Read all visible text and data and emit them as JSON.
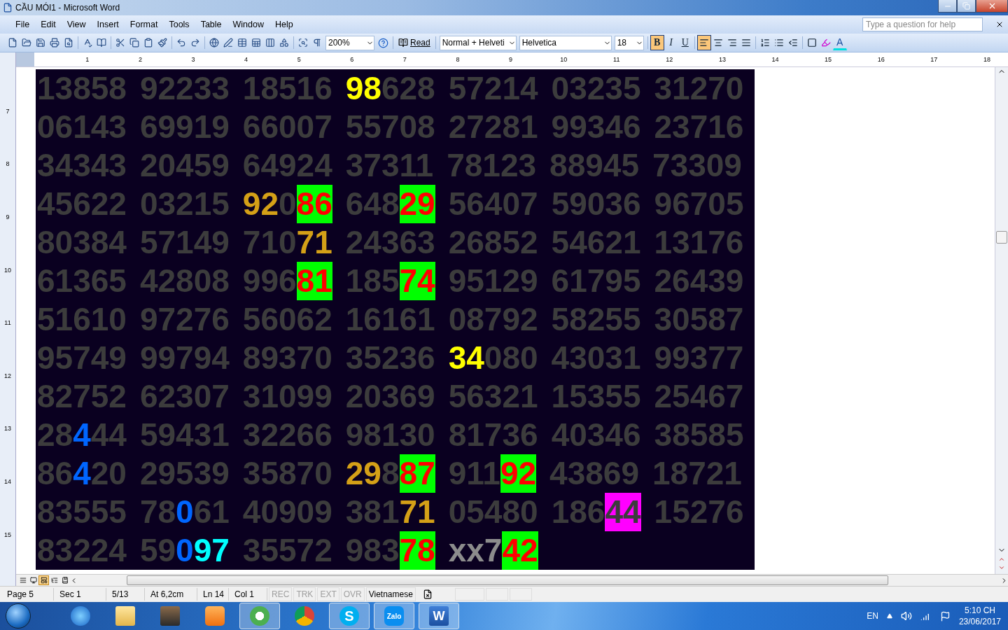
{
  "window": {
    "title": "CẦU MÓI1 - Microsoft Word"
  },
  "menu": [
    "File",
    "Edit",
    "View",
    "Insert",
    "Format",
    "Tools",
    "Table",
    "Window",
    "Help"
  ],
  "help_box": {
    "placeholder": "Type a question for help"
  },
  "standard_toolbar": [
    {
      "kind": "new"
    },
    {
      "kind": "open"
    },
    {
      "kind": "save"
    },
    {
      "kind": "print"
    },
    {
      "kind": "preview"
    },
    {
      "kind": "spelling"
    },
    {
      "kind": "research"
    },
    {
      "kind": "cut"
    },
    {
      "kind": "copy"
    },
    {
      "kind": "paste"
    },
    {
      "kind": "format-painter"
    },
    {
      "kind": "undo"
    },
    {
      "kind": "redo"
    },
    {
      "kind": "hyperlink"
    },
    {
      "kind": "draw-table"
    },
    {
      "kind": "table"
    },
    {
      "kind": "sheet"
    },
    {
      "kind": "columns"
    },
    {
      "kind": "drawing"
    },
    {
      "kind": "document-map"
    },
    {
      "kind": "pilcrow"
    }
  ],
  "zoom": "200%",
  "read_button": "Read",
  "formatting": {
    "style": "Normal + Helveti",
    "font": "Helvetica",
    "size": "18",
    "toggles": [
      {
        "label": "B",
        "kind": "bold",
        "selected": true
      },
      {
        "label": "I",
        "kind": "italic",
        "selected": false
      },
      {
        "label": "U",
        "kind": "underline",
        "selected": false
      }
    ],
    "alignment": [
      {
        "kind": "left",
        "selected": true
      },
      {
        "kind": "center",
        "selected": false
      },
      {
        "kind": "right",
        "selected": false
      },
      {
        "kind": "justify",
        "selected": false
      }
    ],
    "font_color_label": "A"
  },
  "ruler": {
    "horizontal": [
      "1",
      "2",
      "3",
      "4",
      "5",
      "6",
      "7",
      "8",
      "9",
      "10",
      "11",
      "12",
      "13",
      "14",
      "15",
      "16",
      "17",
      "18"
    ],
    "vertical": [
      "7",
      "8",
      "9",
      "10",
      "11",
      "12",
      "13",
      "14",
      "15"
    ]
  },
  "document": {
    "rows": [
      [
        [
          {
            "text": "13858"
          }
        ],
        [
          {
            "text": "92233"
          }
        ],
        [
          {
            "text": "18516"
          }
        ],
        [
          {
            "text": "98",
            "color": "#ffff00"
          },
          {
            "text": "628"
          }
        ],
        [
          {
            "text": "57214"
          }
        ],
        [
          {
            "text": "03235"
          }
        ],
        [
          {
            "text": "31270"
          }
        ]
      ],
      [
        [
          {
            "text": "06143"
          }
        ],
        [
          {
            "text": "69919"
          }
        ],
        [
          {
            "text": "66007"
          }
        ],
        [
          {
            "text": "55708"
          }
        ],
        [
          {
            "text": "27281"
          }
        ],
        [
          {
            "text": "99346"
          }
        ],
        [
          {
            "text": "23716"
          }
        ]
      ],
      [
        [
          {
            "text": "34343"
          }
        ],
        [
          {
            "text": "20459"
          }
        ],
        [
          {
            "text": "64924"
          }
        ],
        [
          {
            "text": "37311"
          }
        ],
        [
          {
            "text": "78123"
          }
        ],
        [
          {
            "text": "88945"
          }
        ],
        [
          {
            "text": "73309"
          }
        ]
      ],
      [
        [
          {
            "text": "45622"
          }
        ],
        [
          {
            "text": "03215"
          }
        ],
        [
          {
            "text": "92",
            "color": "#d4a017"
          },
          {
            "text": "0"
          },
          {
            "text": "86",
            "color": "#ff0000",
            "highlight": {
              "color": "#00ff00"
            }
          }
        ],
        [
          {
            "text": "648"
          },
          {
            "text": "29",
            "color": "#ff0000",
            "highlight": {
              "color": "#00ff00"
            }
          }
        ],
        [
          {
            "text": "56407"
          }
        ],
        [
          {
            "text": "59036"
          }
        ],
        [
          {
            "text": "96705"
          }
        ]
      ],
      [
        [
          {
            "text": "80384"
          }
        ],
        [
          {
            "text": "57149"
          }
        ],
        [
          {
            "text": "710"
          },
          {
            "text": "71",
            "color": "#d4a017"
          }
        ],
        [
          {
            "text": "24363"
          }
        ],
        [
          {
            "text": "26852"
          }
        ],
        [
          {
            "text": "54621"
          }
        ],
        [
          {
            "text": "13176"
          }
        ]
      ],
      [
        [
          {
            "text": "61365"
          }
        ],
        [
          {
            "text": "42808"
          }
        ],
        [
          {
            "text": "996"
          },
          {
            "text": "81",
            "color": "#ff0000",
            "highlight": {
              "color": "#00ff00"
            }
          }
        ],
        [
          {
            "text": "185"
          },
          {
            "text": "74",
            "color": "#ff0000",
            "highlight": {
              "color": "#00ff00"
            }
          }
        ],
        [
          {
            "text": "95129"
          }
        ],
        [
          {
            "text": "61795"
          }
        ],
        [
          {
            "text": "26439"
          }
        ]
      ],
      [
        [
          {
            "text": "51610"
          }
        ],
        [
          {
            "text": "97276"
          }
        ],
        [
          {
            "text": "56062"
          }
        ],
        [
          {
            "text": "16161"
          }
        ],
        [
          {
            "text": "08792"
          }
        ],
        [
          {
            "text": "58255"
          }
        ],
        [
          {
            "text": "30587"
          }
        ]
      ],
      [
        [
          {
            "text": "95749"
          }
        ],
        [
          {
            "text": "99794"
          }
        ],
        [
          {
            "text": "89370"
          }
        ],
        [
          {
            "text": "35236"
          }
        ],
        [
          {
            "text": "34",
            "color": "#ffff00"
          },
          {
            "text": "080"
          }
        ],
        [
          {
            "text": "43031"
          }
        ],
        [
          {
            "text": "99377"
          }
        ]
      ],
      [
        [
          {
            "text": "82752"
          }
        ],
        [
          {
            "text": "62307"
          }
        ],
        [
          {
            "text": "31099"
          }
        ],
        [
          {
            "text": "20369"
          }
        ],
        [
          {
            "text": "56321"
          }
        ],
        [
          {
            "text": "15355"
          }
        ],
        [
          {
            "text": "25467"
          }
        ]
      ],
      [
        [
          {
            "text": "28"
          },
          {
            "text": "4",
            "color": "#0066ff"
          },
          {
            "text": "44"
          }
        ],
        [
          {
            "text": "59431"
          }
        ],
        [
          {
            "text": "32266"
          }
        ],
        [
          {
            "text": "98130"
          }
        ],
        [
          {
            "text": "81736"
          }
        ],
        [
          {
            "text": "40346"
          }
        ],
        [
          {
            "text": "38585"
          }
        ]
      ],
      [
        [
          {
            "text": "86"
          },
          {
            "text": "4",
            "color": "#0066ff"
          },
          {
            "text": "20"
          }
        ],
        [
          {
            "text": "29539"
          }
        ],
        [
          {
            "text": "35870"
          }
        ],
        [
          {
            "text": "29",
            "color": "#d4a017"
          },
          {
            "text": "8"
          },
          {
            "text": "87",
            "color": "#ff0000",
            "highlight": {
              "color": "#00ff00"
            }
          }
        ],
        [
          {
            "text": "911"
          },
          {
            "text": "92",
            "color": "#ff0000",
            "highlight": {
              "color": "#00ff00"
            }
          }
        ],
        [
          {
            "text": "43869"
          }
        ],
        [
          {
            "text": "18721"
          }
        ]
      ],
      [
        [
          {
            "text": "83555"
          }
        ],
        [
          {
            "text": "78"
          },
          {
            "text": "0",
            "color": "#0066ff"
          },
          {
            "text": "61"
          }
        ],
        [
          {
            "text": "40909"
          }
        ],
        [
          {
            "text": "381"
          },
          {
            "text": "71",
            "color": "#d4a017"
          }
        ],
        [
          {
            "text": "05480"
          }
        ],
        [
          {
            "text": "186"
          },
          {
            "text": "44",
            "highlight": {
              "color": "#ff00ff"
            }
          }
        ],
        [
          {
            "text": "15276"
          }
        ]
      ],
      [
        [
          {
            "text": "83224"
          }
        ],
        [
          {
            "text": "59"
          },
          {
            "text": "0",
            "color": "#0066ff"
          },
          {
            "text": "97",
            "color": "#00ffff"
          }
        ],
        [
          {
            "text": "35572"
          }
        ],
        [
          {
            "text": "983"
          },
          {
            "text": "78",
            "color": "#ff0000",
            "highlight": {
              "color": "#00ff00"
            }
          }
        ],
        [
          {
            "text": "xx7",
            "color": "#8c8c8c"
          },
          {
            "text": "42",
            "color": "#ff0000",
            "highlight": {
              "color": "#00ff00"
            }
          }
        ]
      ]
    ]
  },
  "view_buttons": [
    {
      "kind": "normal",
      "selected": false
    },
    {
      "kind": "web",
      "selected": false
    },
    {
      "kind": "print",
      "selected": true
    },
    {
      "kind": "outline",
      "selected": false
    },
    {
      "kind": "reading",
      "selected": false
    }
  ],
  "status_bar": {
    "fields": [
      "Page 5",
      "Sec 1",
      "5/13",
      "At 6,2cm",
      "Ln 14",
      "Col 1"
    ],
    "modes": [
      {
        "label": "REC",
        "disabled": true
      },
      {
        "label": "TRK",
        "disabled": true
      },
      {
        "label": "EXT",
        "disabled": true
      },
      {
        "label": "OVR",
        "disabled": true
      }
    ],
    "language": "Vietnamese"
  },
  "taskbar": {
    "apps": [
      {
        "kind": "ie",
        "active": false
      },
      {
        "kind": "folder",
        "active": false
      },
      {
        "kind": "camera",
        "active": false
      },
      {
        "kind": "media",
        "active": false
      },
      {
        "kind": "coccoc",
        "active": true
      },
      {
        "kind": "chrome",
        "active": false
      },
      {
        "kind": "skype",
        "label": "S",
        "active": true
      },
      {
        "kind": "zalo",
        "label": "Zalo",
        "active": true
      },
      {
        "kind": "word",
        "label": "W",
        "active": true
      }
    ],
    "language": "EN",
    "time": "5:10 CH",
    "date": "23/06/2017"
  }
}
